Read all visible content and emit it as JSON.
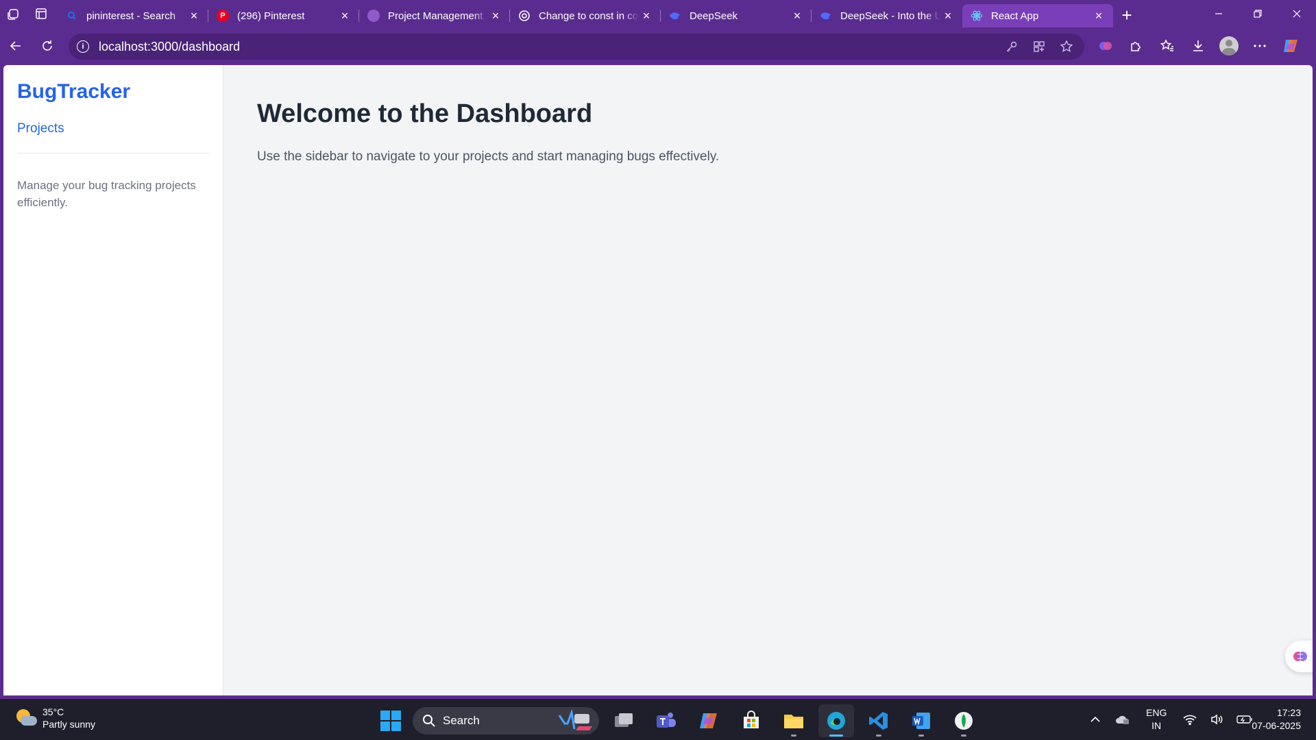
{
  "browser": {
    "tabs": [
      {
        "title": "pininterest - Search",
        "favicon": "search-favicon",
        "favicon_color": "#1a73e8"
      },
      {
        "title": "(296) Pinterest",
        "favicon": "pinterest-favicon",
        "favicon_color": "#e60023"
      },
      {
        "title": "Project Management",
        "favicon": "project-favicon",
        "favicon_color": "#8e5bc8"
      },
      {
        "title": "Change to const in co",
        "favicon": "chatgpt-favicon",
        "favicon_color": "#ffffff"
      },
      {
        "title": "DeepSeek",
        "favicon": "deepseek-favicon",
        "favicon_color": "#4d6bfe"
      },
      {
        "title": "DeepSeek - Into the U",
        "favicon": "deepseek-favicon",
        "favicon_color": "#4d6bfe"
      },
      {
        "title": "React App",
        "favicon": "react-favicon",
        "favicon_color": "#61dafb",
        "active": true
      }
    ],
    "url": "localhost:3000/dashboard"
  },
  "sidebar": {
    "brand": "BugTracker",
    "nav": [
      {
        "label": "Projects"
      }
    ],
    "description": "Manage your bug tracking projects efficiently."
  },
  "main": {
    "heading": "Welcome to the Dashboard",
    "subtext": "Use the sidebar to navigate to your projects and start managing bugs effectively."
  },
  "taskbar": {
    "weather": {
      "temp": "35°C",
      "condition": "Partly sunny"
    },
    "search_label": "Search",
    "lang": {
      "line1": "ENG",
      "line2": "IN"
    },
    "time": "17:23",
    "date": "07-06-2025"
  },
  "colors": {
    "accent": "#2563eb",
    "browser_frame": "#5b2c8f",
    "page_bg": "#f3f4f6"
  }
}
